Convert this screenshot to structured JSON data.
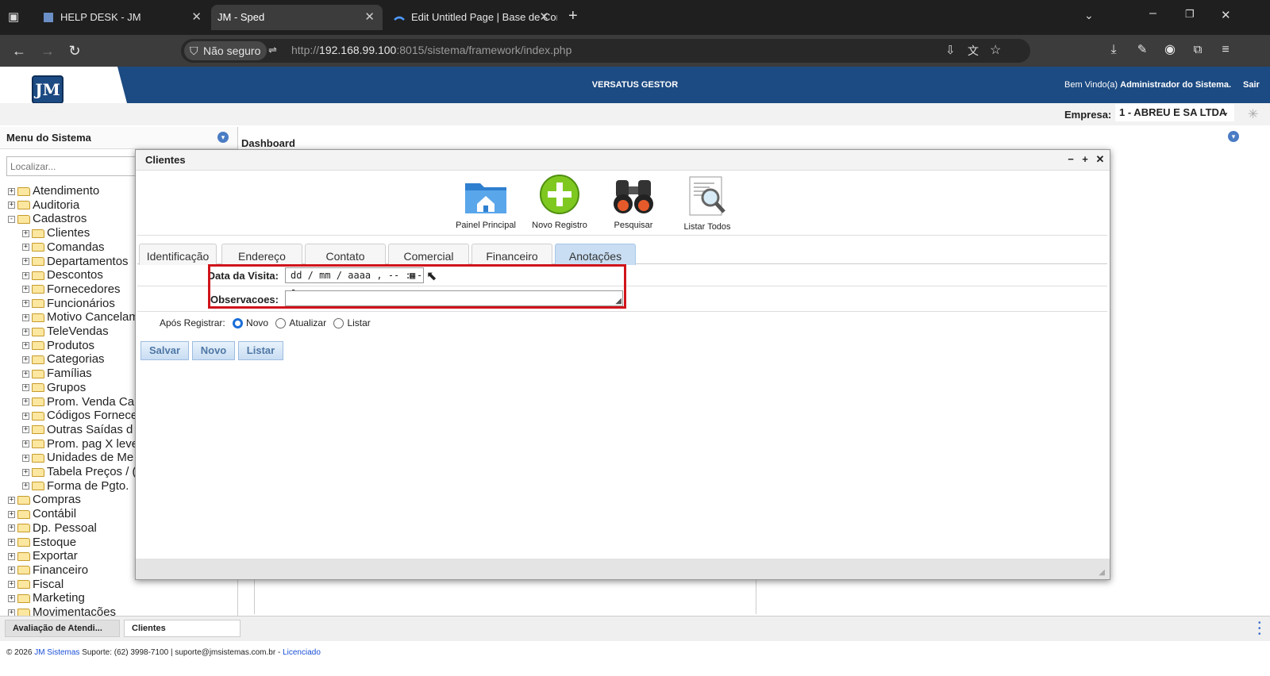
{
  "browser": {
    "tabs": [
      {
        "title": "HELP DESK - JM",
        "active": false
      },
      {
        "title": "JM - Sped",
        "active": true
      },
      {
        "title": "Edit Untitled Page | Base de Cor",
        "active": false
      }
    ],
    "security_label": "Não seguro",
    "url_scheme": "http://",
    "url_host": "192.168.99.100",
    "url_rest": ":8015/sistema/framework/index.php"
  },
  "app": {
    "logo_text": "JM",
    "system_title": "VERSATUS GESTOR",
    "welcome_prefix": "Bem Vindo(a)",
    "welcome_user": "Administrador do Sistema.",
    "logout_label": "Sair",
    "empresa_label": "Empresa:",
    "empresa_value": "1 - ABREU E SA LTDA"
  },
  "sidebar": {
    "title": "Menu do Sistema",
    "search_placeholder": "Localizar...",
    "items": [
      {
        "label": "Atendimento",
        "level": 0,
        "expander": "+"
      },
      {
        "label": "Auditoria",
        "level": 0,
        "expander": "+"
      },
      {
        "label": "Cadastros",
        "level": 0,
        "expander": "-"
      },
      {
        "label": "Clientes",
        "level": 1,
        "expander": "+"
      },
      {
        "label": "Comandas",
        "level": 1,
        "expander": "+"
      },
      {
        "label": "Departamentos",
        "level": 1,
        "expander": "+"
      },
      {
        "label": "Descontos",
        "level": 1,
        "expander": "+"
      },
      {
        "label": "Fornecedores",
        "level": 1,
        "expander": "+"
      },
      {
        "label": "Funcionários",
        "level": 1,
        "expander": "+"
      },
      {
        "label": "Motivo Cancelam",
        "level": 1,
        "expander": "+"
      },
      {
        "label": "TeleVendas",
        "level": 1,
        "expander": "+"
      },
      {
        "label": "Produtos",
        "level": 1,
        "expander": "+"
      },
      {
        "label": "Categorias",
        "level": 1,
        "expander": "+"
      },
      {
        "label": "Famílias",
        "level": 1,
        "expander": "+"
      },
      {
        "label": "Grupos",
        "level": 1,
        "expander": "+"
      },
      {
        "label": "Prom. Venda Ca",
        "level": 1,
        "expander": "+"
      },
      {
        "label": "Códigos Fornece",
        "level": 1,
        "expander": "+"
      },
      {
        "label": "Outras Saídas d",
        "level": 1,
        "expander": "+"
      },
      {
        "label": "Prom. pag X leve",
        "level": 1,
        "expander": "+"
      },
      {
        "label": "Unidades de Me",
        "level": 1,
        "expander": "+"
      },
      {
        "label": "Tabela Preços / (",
        "level": 1,
        "expander": "+"
      },
      {
        "label": "Forma de Pgto.",
        "level": 1,
        "expander": "+"
      },
      {
        "label": "Compras",
        "level": 0,
        "expander": "+"
      },
      {
        "label": "Contábil",
        "level": 0,
        "expander": "+"
      },
      {
        "label": "Dp. Pessoal",
        "level": 0,
        "expander": "+"
      },
      {
        "label": "Estoque",
        "level": 0,
        "expander": "+"
      },
      {
        "label": "Exportar",
        "level": 0,
        "expander": "+"
      },
      {
        "label": "Financeiro",
        "level": 0,
        "expander": "+"
      },
      {
        "label": "Fiscal",
        "level": 0,
        "expander": "+"
      },
      {
        "label": "Marketing",
        "level": 0,
        "expander": "+"
      },
      {
        "label": "Movimentações",
        "level": 0,
        "expander": "+"
      }
    ]
  },
  "dashboard": {
    "title": "Dashboard"
  },
  "modal": {
    "title": "Clientes",
    "toolbar": [
      {
        "label": "Painel Principal",
        "icon": "folder-home-icon"
      },
      {
        "label": "Novo Registro",
        "icon": "plus-circle-icon"
      },
      {
        "label": "Pesquisar",
        "icon": "binoculars-icon"
      },
      {
        "label": "Listar Todos",
        "icon": "document-search-icon"
      }
    ],
    "tabs": [
      {
        "label": "Identificação",
        "active": false
      },
      {
        "label": "Endereço",
        "active": false
      },
      {
        "label": "Contato",
        "active": false
      },
      {
        "label": "Comercial",
        "active": false
      },
      {
        "label": "Financeiro",
        "active": false
      },
      {
        "label": "Anotações",
        "active": true
      }
    ],
    "fields": {
      "visit_date_label": "Data da Visita:",
      "visit_date_value": "dd / mm / aaaa ,  -- : --",
      "notes_label": "Observacoes:",
      "notes_value": ""
    },
    "after_register": {
      "label": "Após Registrar:",
      "options": [
        {
          "label": "Novo",
          "selected": true
        },
        {
          "label": "Atualizar",
          "selected": false
        },
        {
          "label": "Listar",
          "selected": false
        }
      ]
    },
    "buttons": {
      "save": "Salvar",
      "new": "Novo",
      "list": "Listar"
    }
  },
  "taskbar": {
    "tabs": [
      {
        "label": "Avaliação de Atendi...",
        "active": false
      },
      {
        "label": "Clientes",
        "active": true
      }
    ]
  },
  "footer": {
    "copyright": "© 2026",
    "company": "JM Sistemas",
    "support": "Suporte: (62) 3998-7100 | suporte@jmsistemas.com.br -",
    "license": "Licenciado"
  },
  "colors": {
    "header": "#1c4a82",
    "accent": "#1a6ed8",
    "highlight": "#d0141b"
  }
}
